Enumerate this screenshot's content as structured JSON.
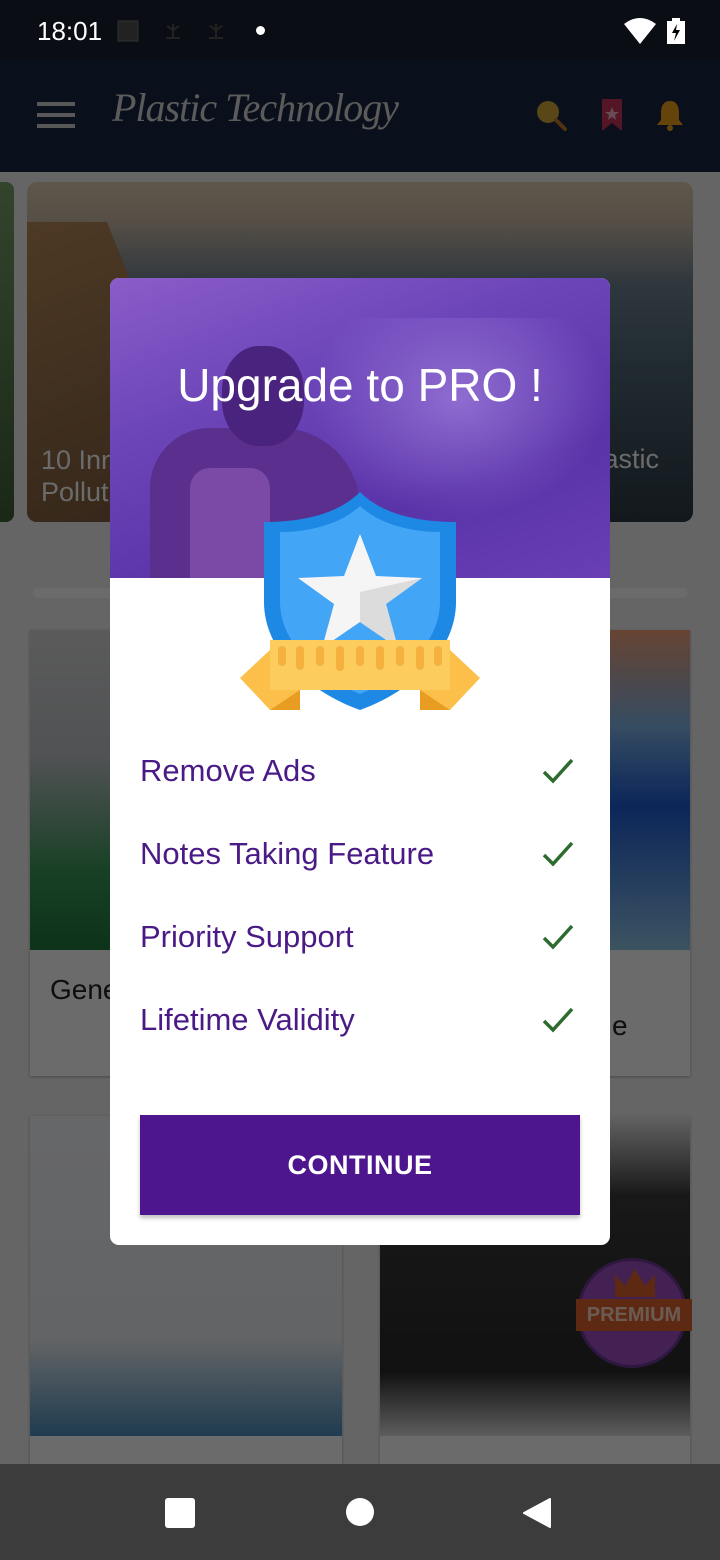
{
  "status_bar": {
    "time": "18:01",
    "notification_icons": [
      "gallery-notification-icon",
      "plant-notification-icon",
      "plant-notification-icon"
    ],
    "wifi": "wifi-icon",
    "battery": "battery-charging-icon"
  },
  "app_bar": {
    "title": "Plastic Technology",
    "icons": [
      "menu-icon",
      "search-icon",
      "bookmark-icon",
      "bell-icon"
    ],
    "colors": {
      "background": "#1a2742",
      "search": "#d4a93a",
      "bookmark": "#c9335c",
      "bell": "#f0a21e"
    }
  },
  "background_content": {
    "hero_caption_left": "10 Inn\nPollut",
    "hero_caption_right": "astic",
    "card_left_label": "Gene",
    "card_right_label": "e",
    "premium_badge_label": "PREMIUM"
  },
  "dialog": {
    "title": "Upgrade to PRO !",
    "features": [
      {
        "label": "Remove Ads",
        "included": true
      },
      {
        "label": "Notes Taking Feature",
        "included": true
      },
      {
        "label": "Priority Support",
        "included": true
      },
      {
        "label": "Lifetime Validity",
        "included": true
      }
    ],
    "continue_label": "CONTINUE",
    "colors": {
      "primary": "#4e168e",
      "feature_text": "#4a1a86",
      "check": "#2e6b2e",
      "header": "#6c45b8"
    }
  },
  "nav_bar": {
    "buttons": [
      "recents-button",
      "home-button",
      "back-button"
    ]
  }
}
